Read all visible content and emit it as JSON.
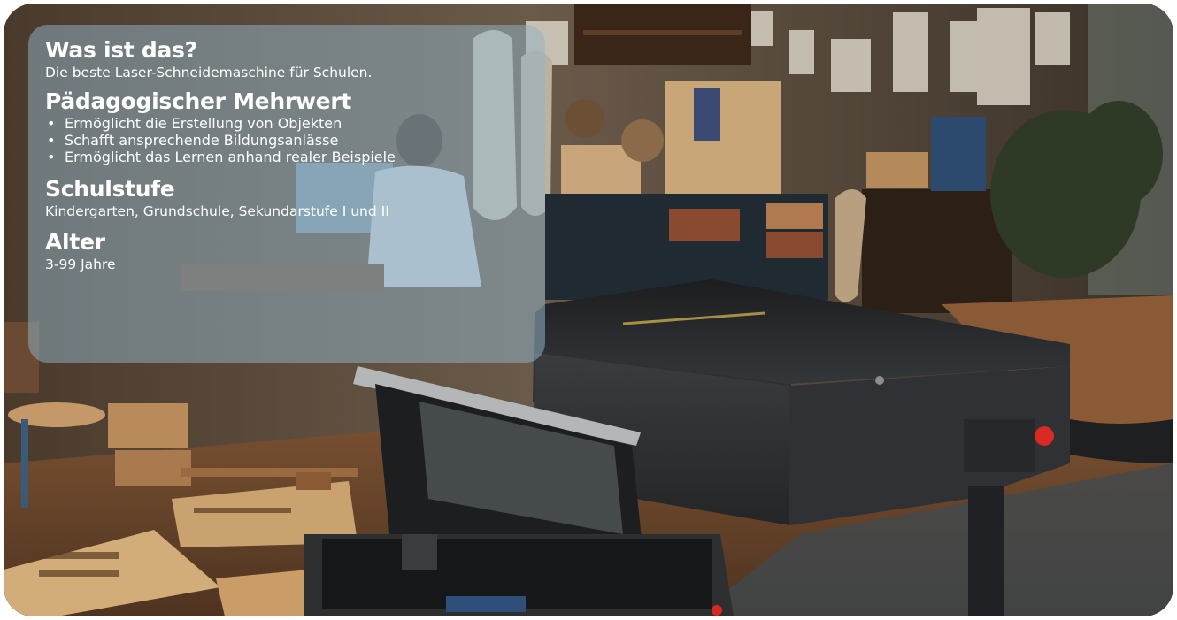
{
  "info_card": {
    "sections": [
      {
        "heading": "Was ist das?",
        "text": "Die beste Laser-Schneidemaschine für Schulen."
      },
      {
        "heading": "Pädagogischer Mehrwert",
        "bullets": [
          "Ermöglicht die Erstellung von Objekten",
          "Schafft ansprechende Bildungsanlässe",
          "Ermöglicht das Lernen anhand realer Beispiele"
        ]
      },
      {
        "heading": "Schulstufe",
        "text": "Kindergarten, Grundschule, Sekundarstufe I und II"
      },
      {
        "heading": "Alter",
        "text": "3-99 Jahre"
      }
    ],
    "bullet_glyph": "•"
  },
  "colors": {
    "panel_tint": "#92b2c6",
    "panel_text": "#ffffff",
    "laser_body": "#2c2e30",
    "wood_table": "#6b4a31",
    "emergency_button": "#d62a22"
  }
}
